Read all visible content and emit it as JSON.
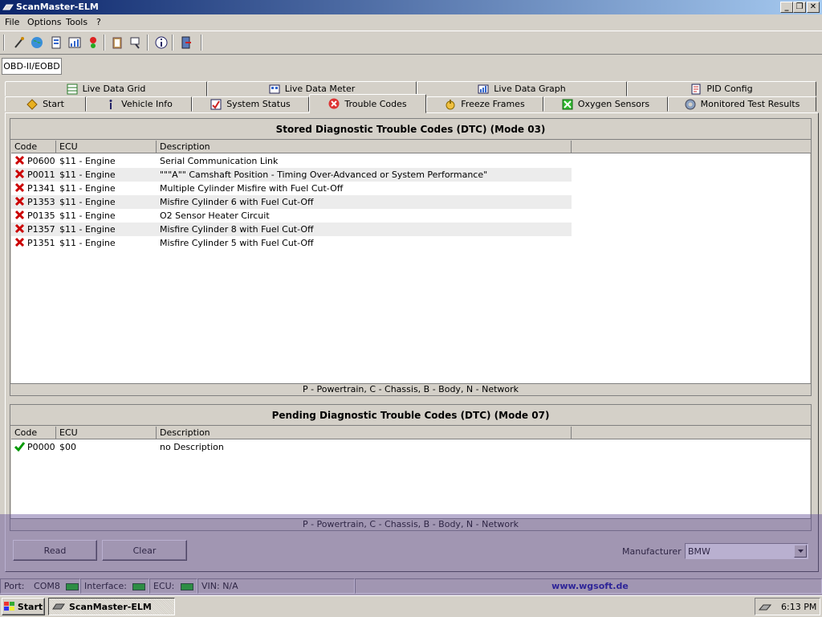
{
  "window": {
    "title": "ScanMaster-ELM"
  },
  "menu": [
    "File",
    "Options",
    "Tools",
    "?"
  ],
  "toolbar_icons": [
    "connect-icon",
    "globe-icon",
    "report-icon",
    "chart-icon",
    "traffic-light-icon",
    "clipboard-icon",
    "search-icon",
    "info-icon",
    "exit-icon"
  ],
  "protocol_tab": "OBD-II/EOBD",
  "tabs_top": [
    {
      "label": "Live Data Grid",
      "icon": "grid-icon"
    },
    {
      "label": "Live Data Meter",
      "icon": "meter-icon"
    },
    {
      "label": "Live Data Graph",
      "icon": "graph-icon"
    },
    {
      "label": "PID Config",
      "icon": "document-icon"
    }
  ],
  "tabs_bottom": [
    {
      "label": "Start",
      "icon": "start-icon"
    },
    {
      "label": "Vehicle Info",
      "icon": "info-icon"
    },
    {
      "label": "System Status",
      "icon": "status-icon"
    },
    {
      "label": "Trouble Codes",
      "icon": "error-icon",
      "active": true
    },
    {
      "label": "Freeze Frames",
      "icon": "freeze-icon"
    },
    {
      "label": "Oxygen Sensors",
      "icon": "oxygen-icon"
    },
    {
      "label": "Monitored Test Results",
      "icon": "gear-icon"
    }
  ],
  "stored": {
    "title": "Stored Diagnostic Trouble Codes (DTC) (Mode 03)",
    "columns": [
      "Code",
      "ECU",
      "Description"
    ],
    "rows": [
      {
        "code": "P0600",
        "ecu": "$11 - Engine",
        "description": "Serial Communication Link"
      },
      {
        "code": "P0011",
        "ecu": "$11 - Engine",
        "description": "\"\"\"A\"\" Camshaft Position - Timing Over-Advanced or System Performance\""
      },
      {
        "code": "P1341",
        "ecu": "$11 - Engine",
        "description": "Multiple Cylinder Misfire with Fuel Cut-Off"
      },
      {
        "code": "P1353",
        "ecu": "$11 - Engine",
        "description": "Misfire Cylinder 6 with Fuel Cut-Off"
      },
      {
        "code": "P0135",
        "ecu": "$11 - Engine",
        "description": "O2 Sensor Heater Circuit"
      },
      {
        "code": "P1357",
        "ecu": "$11 - Engine",
        "description": "Misfire Cylinder 8 with Fuel Cut-Off"
      },
      {
        "code": "P1351",
        "ecu": "$11 - Engine",
        "description": "Misfire Cylinder 5 with Fuel Cut-Off"
      }
    ],
    "legend": "P - Powertrain, C - Chassis, B - Body, N - Network"
  },
  "pending": {
    "title": "Pending Diagnostic Trouble Codes (DTC) (Mode 07)",
    "columns": [
      "Code",
      "ECU",
      "Description"
    ],
    "rows": [
      {
        "code": "P0000",
        "ecu": "$00",
        "description": "no Description"
      }
    ],
    "legend": "P - Powertrain, C - Chassis, B - Body, N - Network"
  },
  "buttons": {
    "read": "Read",
    "clear": "Clear"
  },
  "manufacturer": {
    "label": "Manufacturer",
    "value": "BMW"
  },
  "status": {
    "port_label": "Port:",
    "port_value": "COM8",
    "interface_label": "Interface:",
    "ecu_label": "ECU:",
    "vin": "VIN: N/A",
    "website": "www.wgsoft.de"
  },
  "taskbar": {
    "start": "Start",
    "task": "ScanMaster-ELM",
    "clock": "6:13 PM"
  },
  "colors": {
    "title_start": "#0a246a",
    "title_end": "#a6caf0",
    "led": "#00c000",
    "error": "#cc0000",
    "ok": "#009900",
    "link": "#000099"
  }
}
